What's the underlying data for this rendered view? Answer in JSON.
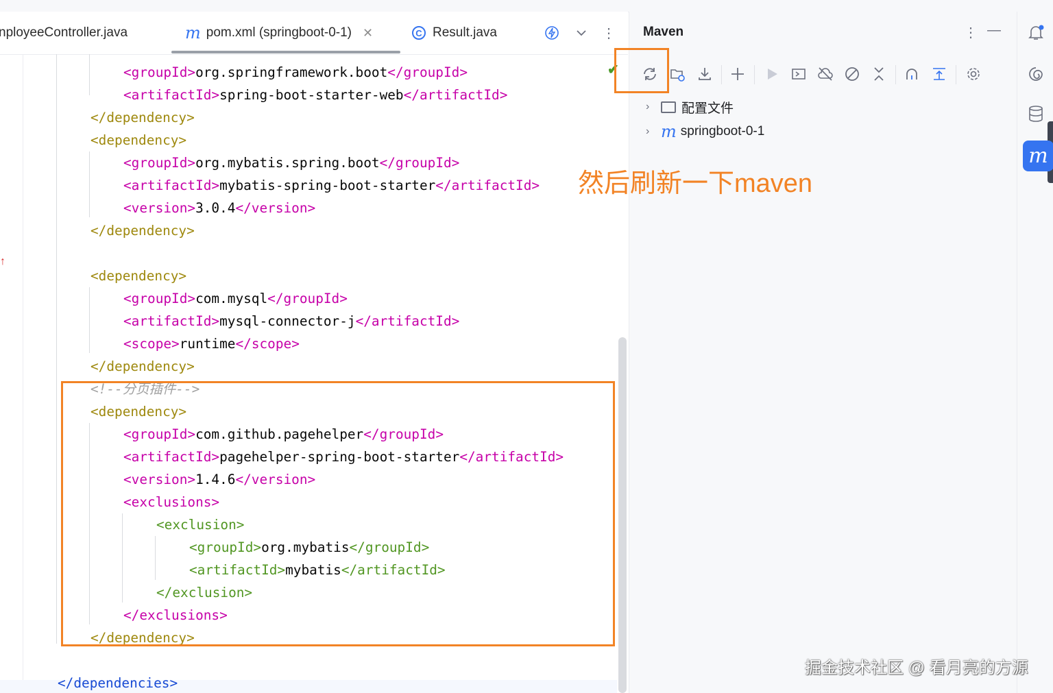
{
  "editor": {
    "tabs": [
      {
        "label": "nployeeController.java",
        "icon": "class-icon"
      },
      {
        "label": "pom.xml (springboot-0-1)",
        "icon": "maven-m-icon",
        "active": true
      },
      {
        "label": "Result.java",
        "icon": "class-icon"
      }
    ],
    "code_lines": [
      {
        "indent": 2,
        "open": "<groupId>",
        "text": "org.springframework.boot",
        "close": "</groupId>",
        "color": "pink"
      },
      {
        "indent": 2,
        "open": "<artifactId>",
        "text": "spring-boot-starter-web",
        "close": "</artifactId>",
        "color": "pink"
      },
      {
        "indent": 1,
        "open": "</dependency>",
        "text": "",
        "close": "",
        "color": "gold"
      },
      {
        "indent": 1,
        "open": "<dependency>",
        "text": "",
        "close": "",
        "color": "gold"
      },
      {
        "indent": 2,
        "open": "<groupId>",
        "text": "org.mybatis.spring.boot",
        "close": "</groupId>",
        "color": "pink"
      },
      {
        "indent": 2,
        "open": "<artifactId>",
        "text": "mybatis-spring-boot-starter",
        "close": "</artifactId>",
        "color": "pink"
      },
      {
        "indent": 2,
        "open": "<version>",
        "text": "3.0.4",
        "close": "</version>",
        "color": "pink"
      },
      {
        "indent": 1,
        "open": "</dependency>",
        "text": "",
        "close": "",
        "color": "gold"
      },
      {
        "indent": 0,
        "open": "",
        "text": "",
        "close": "",
        "color": "none"
      },
      {
        "indent": 1,
        "open": "<dependency>",
        "text": "",
        "close": "",
        "color": "gold"
      },
      {
        "indent": 2,
        "open": "<groupId>",
        "text": "com.mysql",
        "close": "</groupId>",
        "color": "pink"
      },
      {
        "indent": 2,
        "open": "<artifactId>",
        "text": "mysql-connector-j",
        "close": "</artifactId>",
        "color": "pink"
      },
      {
        "indent": 2,
        "open": "<scope>",
        "text": "runtime",
        "close": "</scope>",
        "color": "pink"
      },
      {
        "indent": 1,
        "open": "</dependency>",
        "text": "",
        "close": "",
        "color": "gold"
      },
      {
        "indent": 1,
        "open": "",
        "text": "<!--分页插件-->",
        "close": "",
        "color": "comment"
      },
      {
        "indent": 1,
        "open": "<dependency>",
        "text": "",
        "close": "",
        "color": "gold"
      },
      {
        "indent": 2,
        "open": "<groupId>",
        "text": "com.github.pagehelper",
        "close": "</groupId>",
        "color": "pink"
      },
      {
        "indent": 2,
        "open": "<artifactId>",
        "text": "pagehelper-spring-boot-starter",
        "close": "</artifactId>",
        "color": "pink"
      },
      {
        "indent": 2,
        "open": "<version>",
        "text": "1.4.6",
        "close": "</version>",
        "color": "pink"
      },
      {
        "indent": 2,
        "open": "<exclusions>",
        "text": "",
        "close": "",
        "color": "pink"
      },
      {
        "indent": 3,
        "open": "<exclusion>",
        "text": "",
        "close": "",
        "color": "green"
      },
      {
        "indent": 4,
        "open": "<groupId>",
        "text": "org.mybatis",
        "close": "</groupId>",
        "color": "green"
      },
      {
        "indent": 4,
        "open": "<artifactId>",
        "text": "mybatis",
        "close": "</artifactId>",
        "color": "green"
      },
      {
        "indent": 3,
        "open": "</exclusion>",
        "text": "",
        "close": "",
        "color": "green"
      },
      {
        "indent": 2,
        "open": "</exclusions>",
        "text": "",
        "close": "",
        "color": "pink"
      },
      {
        "indent": 1,
        "open": "</dependency>",
        "text": "",
        "close": "",
        "color": "gold"
      },
      {
        "indent": 0,
        "open": "",
        "text": "",
        "close": "",
        "color": "none"
      },
      {
        "indent": 0,
        "open": "</dependencies>",
        "text": "",
        "close": "",
        "color": "blue"
      }
    ]
  },
  "maven_panel": {
    "title": "Maven",
    "toolbar_icons": [
      "reload-icon",
      "generate-sources-icon",
      "download-icon",
      "add-icon",
      "run-icon",
      "execute-goal-icon",
      "offline-icon",
      "skip-tests-icon",
      "collapse-icon",
      "show-dependencies-icon",
      "analyze-icon",
      "settings-icon"
    ],
    "tree": [
      {
        "label": "配置文件",
        "icon": "folder-icon"
      },
      {
        "label": "springboot-0-1",
        "icon": "maven-m-icon"
      }
    ]
  },
  "annotation": {
    "text": "然后刷新一下maven",
    "color": "#f28325"
  },
  "watermark": "掘金技术社区 @ 看月亮的方源"
}
